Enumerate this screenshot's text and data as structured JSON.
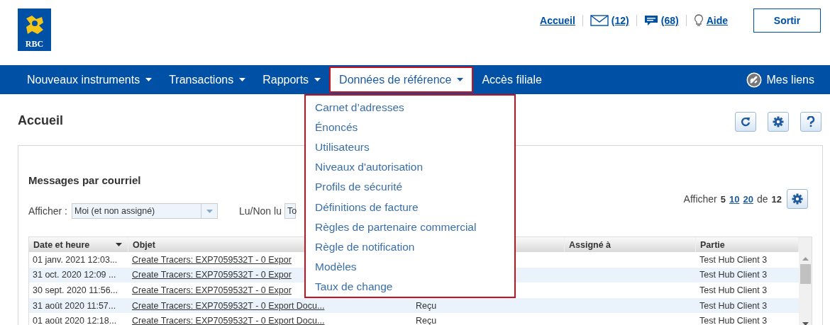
{
  "logo": {
    "text": "RBC"
  },
  "top_links": {
    "home": "Accueil",
    "mail_count": "(12)",
    "messages_count": "(68)",
    "help": "Aide",
    "logout": "Sortir"
  },
  "nav": {
    "items": [
      {
        "label": "Nouveaux instruments",
        "caret": true,
        "selected": false
      },
      {
        "label": "Transactions",
        "caret": true,
        "selected": false
      },
      {
        "label": "Rapports",
        "caret": true,
        "selected": false
      },
      {
        "label": "Données de référence",
        "caret": true,
        "selected": true
      },
      {
        "label": "Accès filiale",
        "caret": false,
        "selected": false
      }
    ],
    "my_links": "Mes liens"
  },
  "dropdown": {
    "items": [
      "Carnet d’adresses",
      "Énoncés",
      "Utilisateurs",
      "Niveaux d'autorisation",
      "Profils de sécurité",
      "Définitions de facture",
      "Règles de partenaire commercial",
      "Règle de notification",
      "Modèles",
      "Taux de change"
    ]
  },
  "page_title": "Accueil",
  "panel": {
    "title": "Messages par courriel",
    "filter_label": "Afficher :",
    "filter_value": "Moi (et non assigné)",
    "read_label": "Lu/Non lu",
    "read_value": "To",
    "pager": {
      "label": "Afficher",
      "sizes": [
        {
          "label": "5",
          "selected": true
        },
        {
          "label": "10",
          "selected": false
        },
        {
          "label": "20",
          "selected": false
        }
      ],
      "of": "de",
      "total": "12"
    },
    "table": {
      "columns": [
        "Date et heure",
        "Objet",
        "",
        "Assigné à",
        "Partie"
      ],
      "rows": [
        {
          "date": "01 janv. 2021 12:03...",
          "subject": "Create Tracers: EXP7059532T - 0 Expor",
          "party": "Test Hub Client 3"
        },
        {
          "date": "31 oct. 2020 12:09 ...",
          "subject": "Create Tracers: EXP7059532T - 0 Expor",
          "party": "Test Hub Client 3"
        },
        {
          "date": "30 sept. 2020 11:56...",
          "subject": "Create Tracers: EXP7059532T - 0 Expor",
          "party": "Test Hub Client 3"
        },
        {
          "date": "31 août 2020 11:57...",
          "subject": "Create Tracers: EXP7059532T - 0 Export Docu...",
          "column_3": "Reçu",
          "party": "Test Hub Client 3"
        },
        {
          "date": "01 août 2020 12:18...",
          "subject": "Create Tracers: EXP7059532T - 0 Export Docu...",
          "column_3": "Reçu",
          "party": "Test Hub Client 3"
        }
      ]
    }
  }
}
